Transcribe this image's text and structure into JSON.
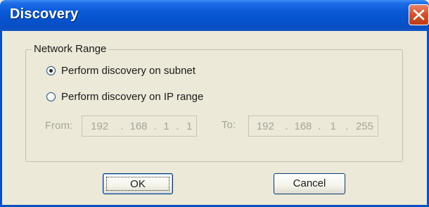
{
  "window": {
    "title": "Discovery",
    "close_icon": "close-icon"
  },
  "network_range": {
    "group_label": "Network Range",
    "options": [
      {
        "label": "Perform discovery on subnet",
        "checked": true
      },
      {
        "label": "Perform discovery on IP range",
        "checked": false
      }
    ],
    "from_label": "From:",
    "to_label": "To:",
    "from_ip": [
      "192",
      "168",
      "1",
      "1"
    ],
    "to_ip": [
      "192",
      "168",
      "1",
      "255"
    ]
  },
  "buttons": {
    "ok_label": "OK",
    "cancel_label": "Cancel"
  },
  "colors": {
    "titlebar": "#0a5bd9",
    "close_button": "#d8522c",
    "dialog_bg": "#ece9d8"
  }
}
